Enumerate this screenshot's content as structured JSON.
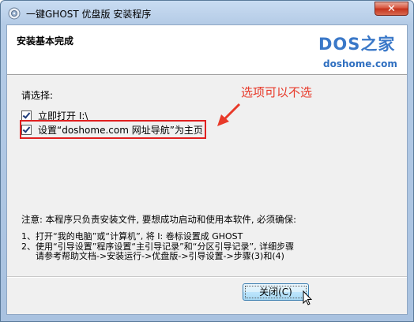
{
  "window": {
    "title": "一键GHOST 优盘版 安装程序",
    "close_glyph": "✕"
  },
  "header": {
    "title": "安装基本完成",
    "logo_main": "DOS之家",
    "logo_url": "doshome.com"
  },
  "options": {
    "prompt": "请选择:",
    "items": [
      {
        "label": "立即打开 I:\\",
        "checked": true
      },
      {
        "label": "设置“doshome.com 网址导航”为主页",
        "checked": true
      }
    ]
  },
  "annotation": {
    "text": "选项可以不选",
    "color": "#e83a2a"
  },
  "notice": {
    "heading": "注意: 本程序只负责安装文件, 要想成功启动和使用本软件, 必须确保:",
    "steps": [
      "1、打开“我的电脑”或“计算机”, 将 I: 卷标设置成 GHOST",
      "2、使用“引导设置”程序设置“主引导记录”和“分区引导记录”, 详细步骤",
      "   请参考帮助文档->安装运行->优盘版->引导设置->步骤(3)和(4)"
    ]
  },
  "buttons": {
    "close_label": "关闭(C)"
  },
  "colors": {
    "logo_blue": "#3a78c8",
    "highlight_red": "#e02020"
  }
}
